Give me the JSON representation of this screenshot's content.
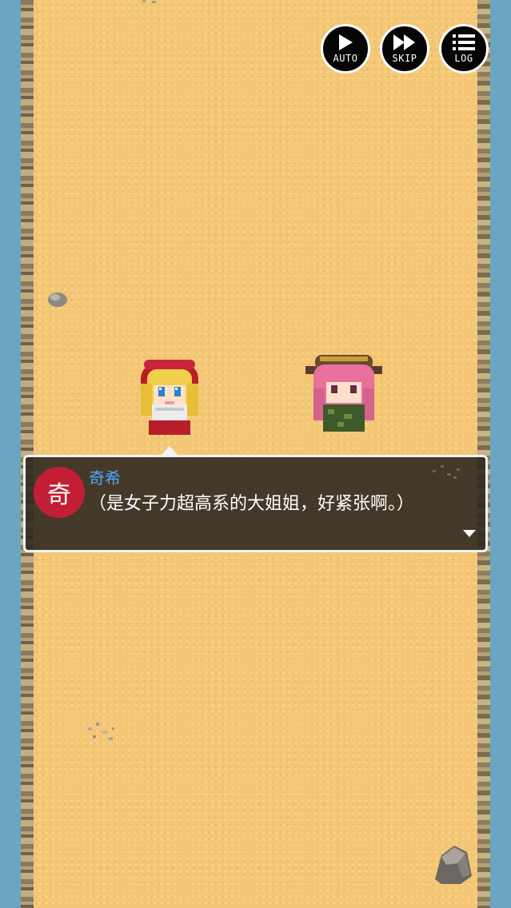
{
  "controls": {
    "auto_label": "AUTO",
    "skip_label": "SKIP",
    "log_label": "LOG"
  },
  "dialog": {
    "portrait_char": "奇",
    "speaker": "奇希",
    "text": "（是女子力超高系的大姐姐，好紧张啊。）"
  },
  "colors": {
    "sand": "#f4c776",
    "water": "#6aa6c4",
    "portrait": "#c21f35",
    "speaker_name": "#4aa8ff"
  }
}
